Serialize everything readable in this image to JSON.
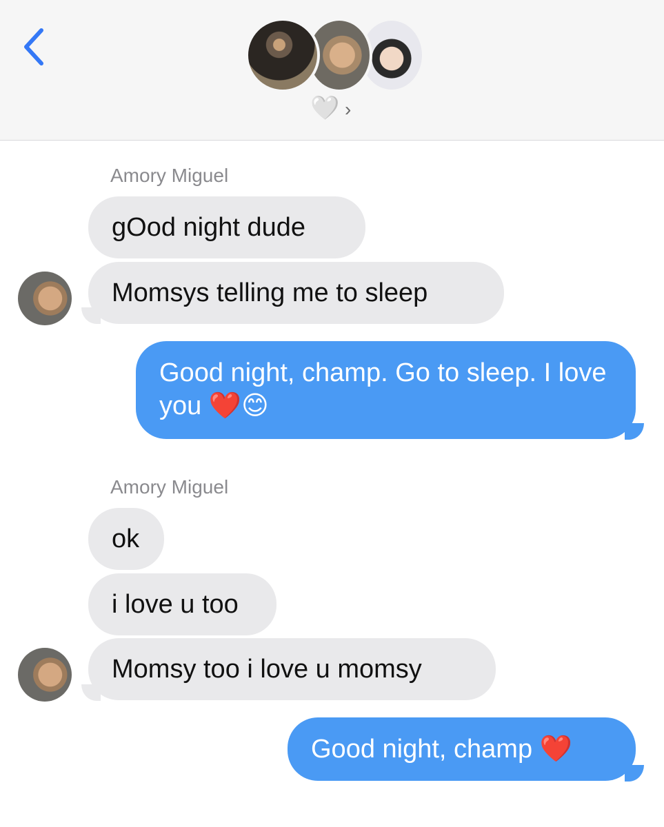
{
  "header": {
    "back_icon": "chevron-left-icon",
    "group_name": "🤍",
    "group_chevron": "›",
    "colors": {
      "accent": "#3478f6",
      "header_bg": "#f6f6f6"
    }
  },
  "messages": {
    "sender_1": "Amory Miguel",
    "in_1": "gOod night dude",
    "in_2": "Momsys telling me to sleep",
    "out_1": "Good night, champ. Go to sleep. I love you ❤️😊",
    "sender_2": "Amory Miguel",
    "in_3": "ok",
    "in_4": "i love u too",
    "in_5": "Momsy too i love u momsy",
    "out_2": "Good night, champ ❤️",
    "colors": {
      "incoming": "#e9e9eb",
      "outgoing": "#4a9af4"
    }
  }
}
